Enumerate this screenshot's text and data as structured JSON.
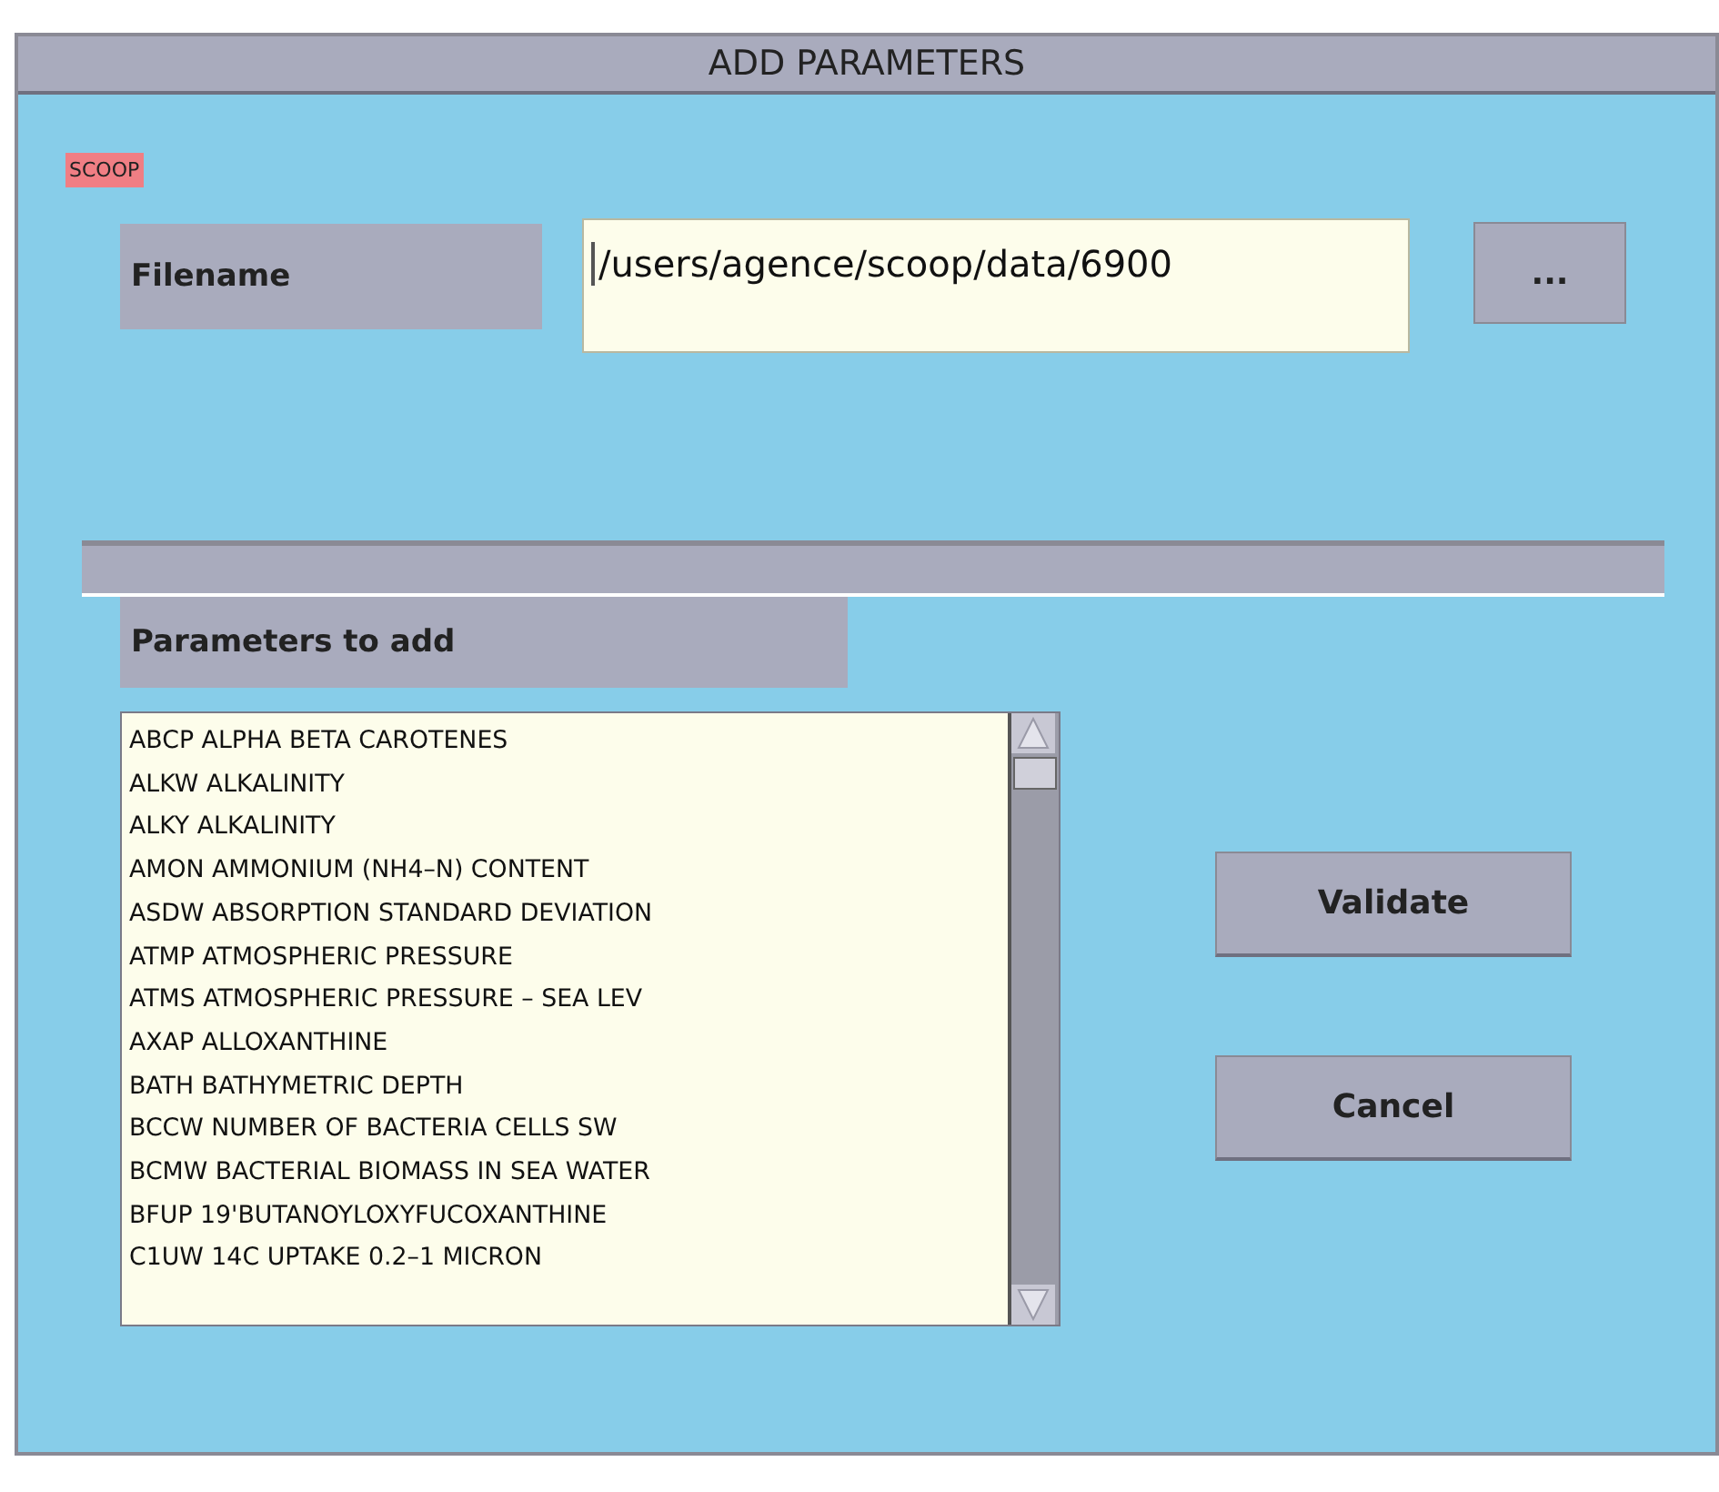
{
  "window": {
    "title": "ADD PARAMETERS"
  },
  "tag": "SCOOP",
  "filename": {
    "label": "Filename",
    "value": "/users/agence/scoop/data/6900",
    "browse": "..."
  },
  "parameters": {
    "label": "Parameters to add",
    "items": [
      "ABCP ALPHA BETA CAROTENES",
      "ALKW ALKALINITY",
      "ALKY ALKALINITY",
      "AMON AMMONIUM (NH4–N) CONTENT",
      "ASDW ABSORPTION STANDARD DEVIATION",
      "ATMP ATMOSPHERIC PRESSURE",
      "ATMS ATMOSPHERIC PRESSURE – SEA LEV",
      "AXAP ALLOXANTHINE",
      "BATH BATHYMETRIC DEPTH",
      "BCCW NUMBER OF BACTERIA CELLS SW",
      "BCMW BACTERIAL BIOMASS IN SEA WATER",
      "BFUP 19'BUTANOYLOXYFUCOXANTHINE",
      "C1UW 14C UPTAKE 0.2–1 MICRON"
    ]
  },
  "buttons": [
    "Validate",
    "Cancel"
  ]
}
